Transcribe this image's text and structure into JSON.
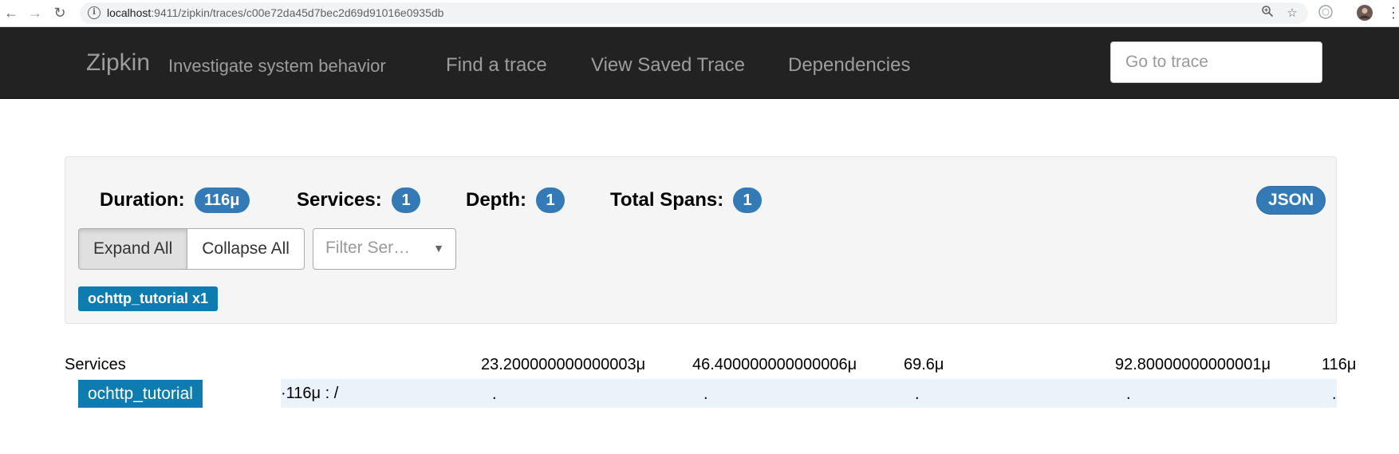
{
  "browser": {
    "url_host": "localhost",
    "url_path": ":9411/zipkin/traces/c00e72da45d7bec2d69d91016e0935db"
  },
  "navbar": {
    "brand": "Zipkin",
    "tagline": "Investigate system behavior",
    "links": [
      "Find a trace",
      "View Saved Trace",
      "Dependencies"
    ],
    "go_placeholder": "Go to trace"
  },
  "summary": {
    "duration_label": "Duration:",
    "duration_value": "116μ",
    "services_label": "Services:",
    "services_value": "1",
    "depth_label": "Depth:",
    "depth_value": "1",
    "total_spans_label": "Total Spans:",
    "total_spans_value": "1",
    "json_label": "JSON",
    "expand_all": "Expand All",
    "collapse_all": "Collapse All",
    "filter_placeholder": "Filter Ser…",
    "service_tag": "ochttp_tutorial x1"
  },
  "timeline": {
    "services_header": "Services",
    "ticks": [
      "23.200000000000003μ",
      "46.400000000000006μ",
      "69.6μ",
      "92.80000000000001μ",
      "116μ"
    ],
    "rows": [
      {
        "service": "ochttp_tutorial",
        "span_label": "·116μ : /",
        "marker": "."
      }
    ]
  }
}
